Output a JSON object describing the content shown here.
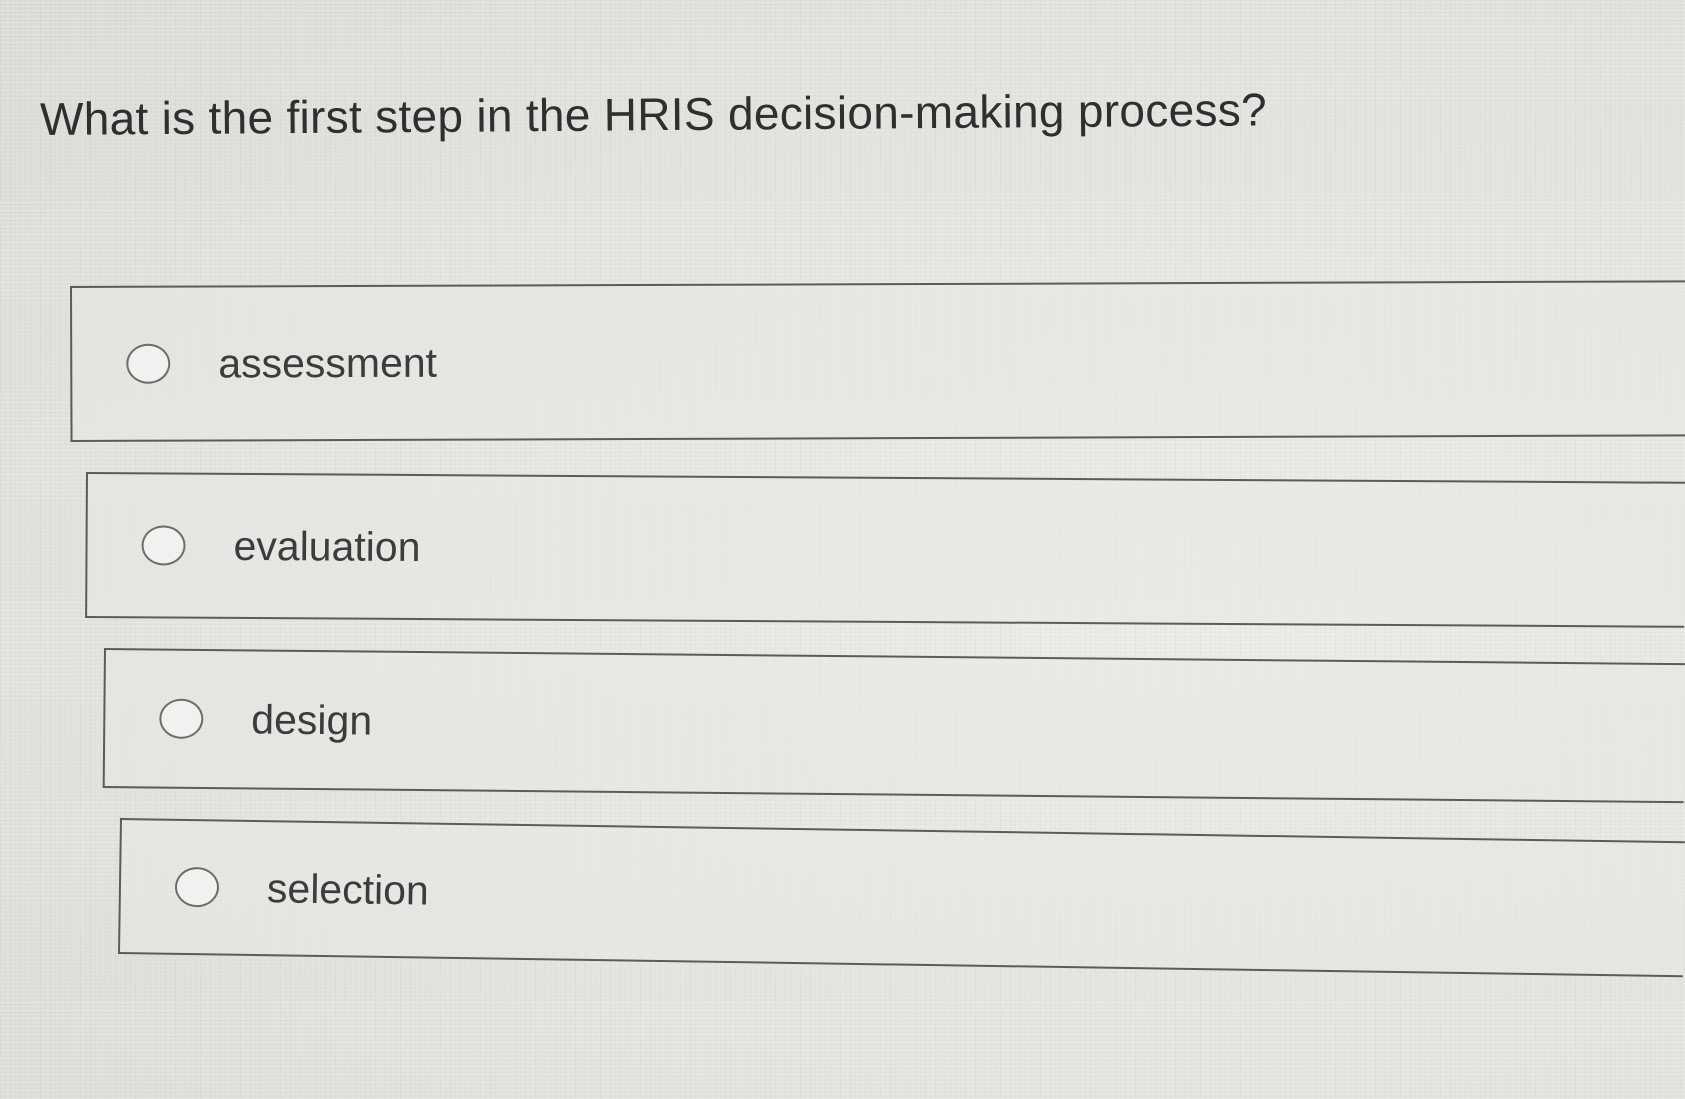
{
  "question": {
    "text": "What is the first step in the HRIS decision-making process?"
  },
  "options": [
    {
      "label": "assessment",
      "selected": false
    },
    {
      "label": "evaluation",
      "selected": false
    },
    {
      "label": "design",
      "selected": false
    },
    {
      "label": "selection",
      "selected": false
    }
  ]
}
